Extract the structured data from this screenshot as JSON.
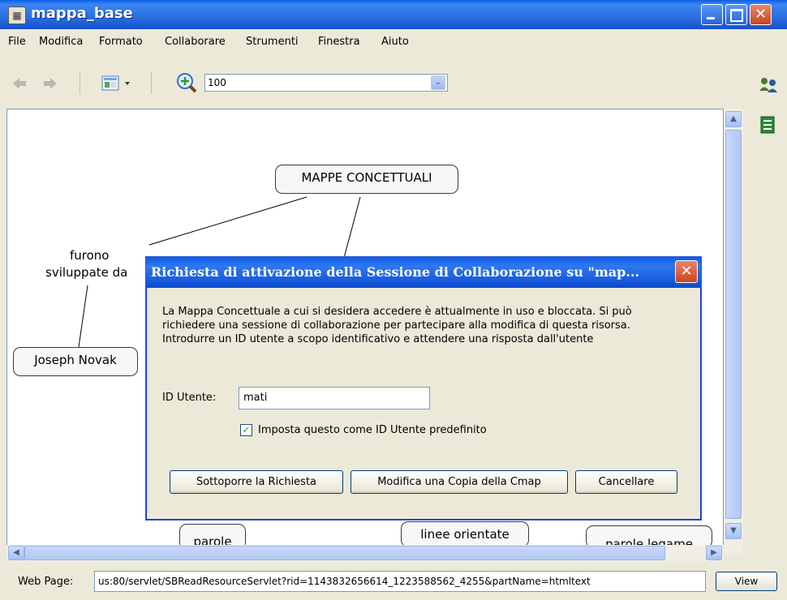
{
  "window": {
    "title": "mappa_base"
  },
  "menu": [
    "File",
    "Modifica",
    "Formato",
    "Collaborare",
    "Strumenti",
    "Finestra",
    "Aiuto"
  ],
  "toolbar": {
    "zoom_value": "100"
  },
  "map": {
    "nodes": {
      "main": "MAPPE CONCETTUALI",
      "novak": "Joseph Novak",
      "parole": "parole",
      "linee": "linee orientate",
      "legame": "parole legame"
    },
    "link_text": {
      "line1": "furono",
      "line2": "sviluppate da"
    }
  },
  "dialog": {
    "title": "Richiesta di attivazione della Sessione di Collaborazione su \"map...",
    "message": "La Mappa Concettuale a cui si desidera accedere è attualmente in uso e bloccata. Si può richiedere una sessione di collaborazione per partecipare alla modifica di questa risorsa. Introdurre un ID utente a scopo identificativo e attendere una risposta dall'utente",
    "user_id_label": "ID Utente:",
    "user_id_value": "mati",
    "default_checkbox_label": "Imposta questo come ID Utente predefinito",
    "default_checked": true,
    "buttons": {
      "submit": "Sottoporre la Richiesta",
      "edit_copy": "Modifica una Copia della Cmap",
      "cancel": "Cancellare"
    }
  },
  "statusbar": {
    "label": "Web Page:",
    "url": "us:80/servlet/SBReadResourceServlet?rid=1143832656614_1223588562_4255&partName=htmltext",
    "view_button": "View"
  }
}
